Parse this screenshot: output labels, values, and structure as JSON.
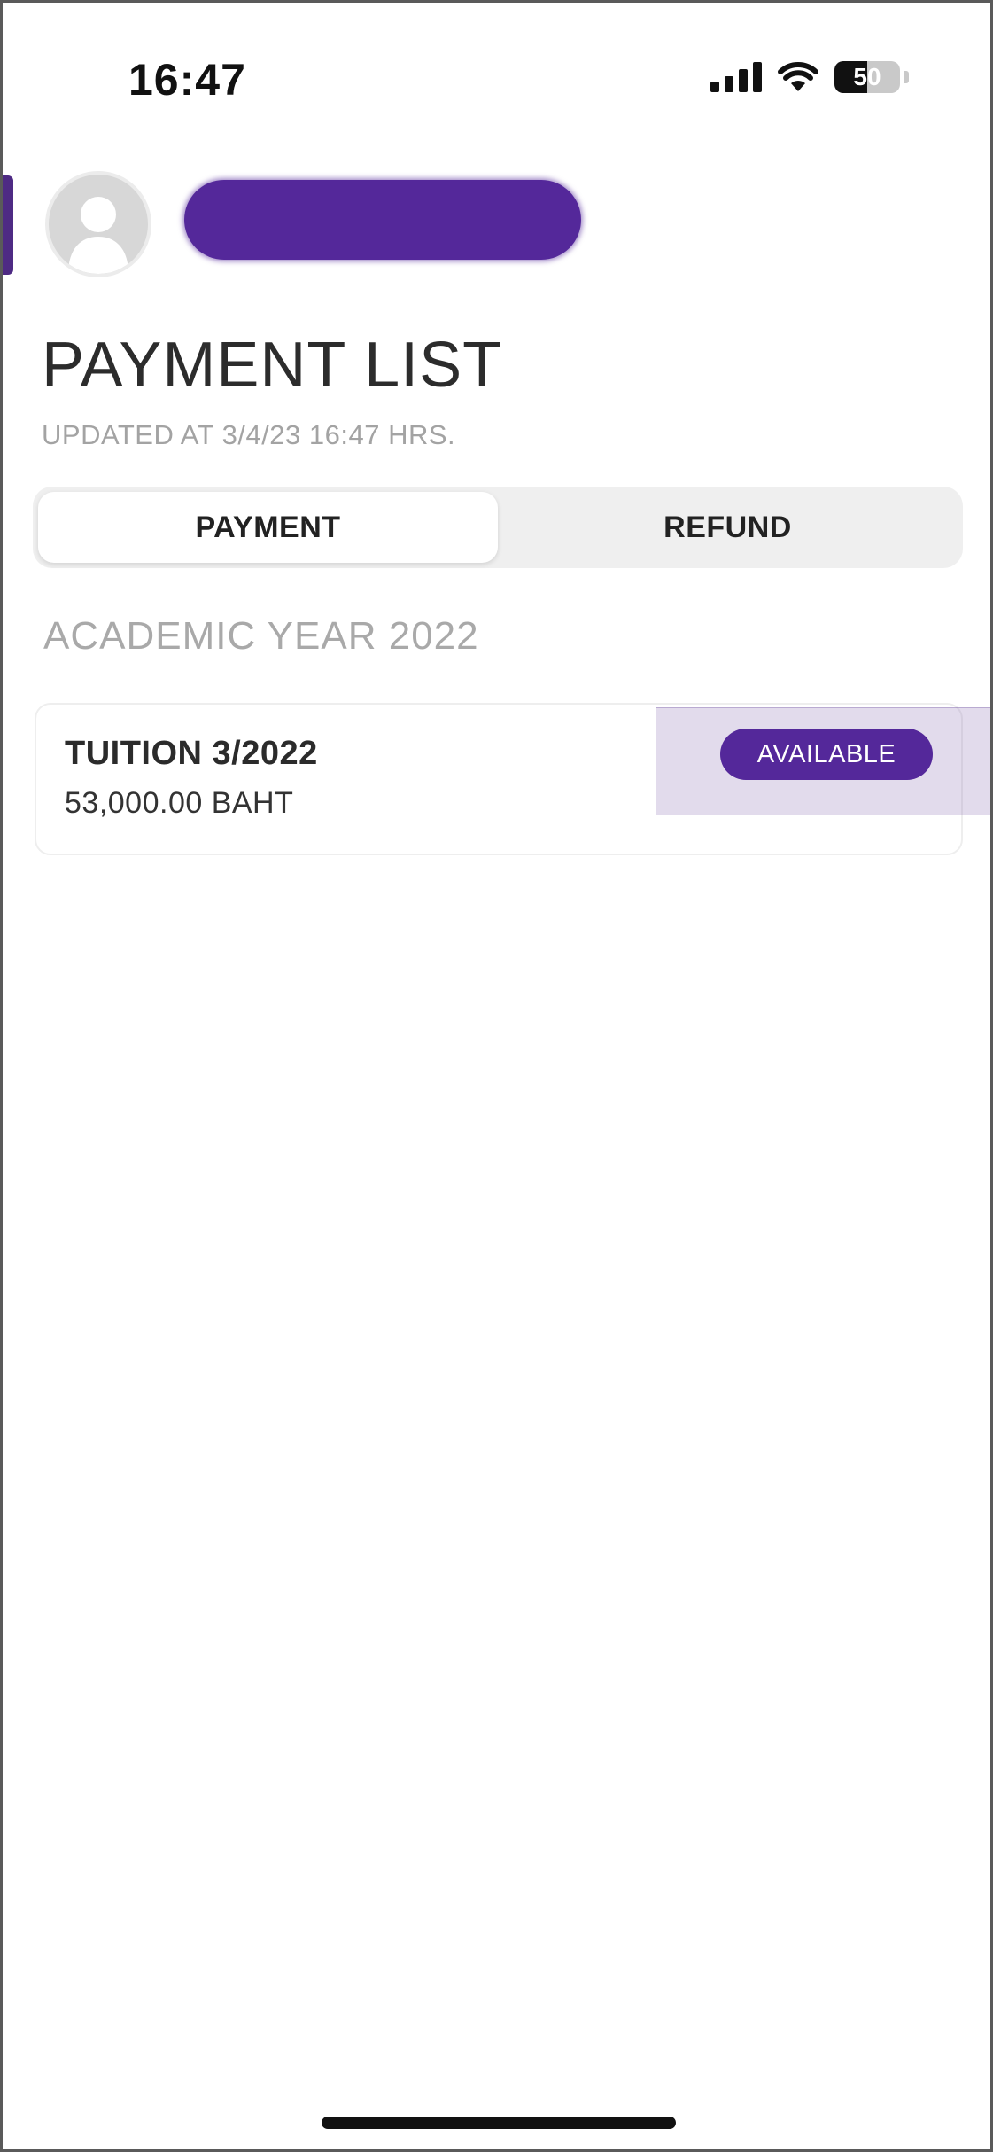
{
  "status_bar": {
    "time": "16:47",
    "battery_level": "50",
    "icons": [
      "signal-icon",
      "wifi-icon",
      "battery-icon"
    ]
  },
  "profile": {
    "avatar_icon": "user-silhouette-icon",
    "name_redacted": true
  },
  "page": {
    "title": "PAYMENT LIST",
    "updated": "UPDATED AT 3/4/23 16:47 HRS."
  },
  "tabs": [
    {
      "label": "PAYMENT",
      "active": true
    },
    {
      "label": "REFUND",
      "active": false
    }
  ],
  "section": {
    "title": "ACADEMIC YEAR 2022"
  },
  "payments": [
    {
      "title": "TUITION 3/2022",
      "amount": "53,000.00 BAHT",
      "status": "AVAILABLE"
    }
  ],
  "colors": {
    "accent": "#54289a",
    "tab_bg": "#efefef",
    "muted_text": "#a3a3a3"
  }
}
